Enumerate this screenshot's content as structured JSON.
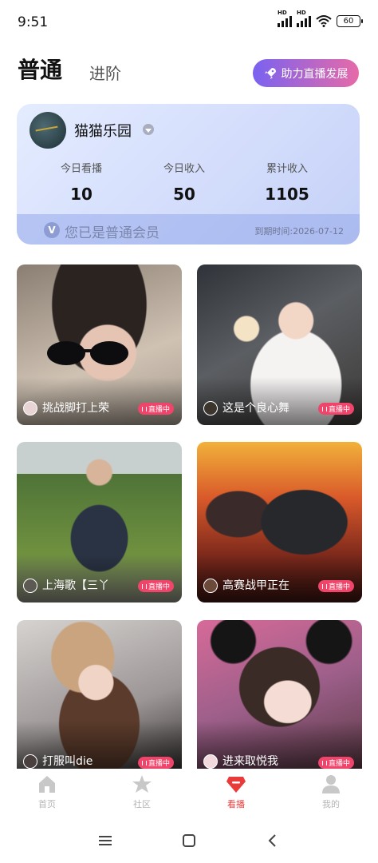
{
  "status_bar": {
    "time": "9:51",
    "battery": "60",
    "signal1": "HD",
    "signal2": "HD"
  },
  "tabs": {
    "normal": "普通",
    "advanced": "进阶"
  },
  "boost_button": {
    "label": "助力直播发展"
  },
  "member_card": {
    "name": "猫猫乐园",
    "stats": [
      {
        "label": "今日看播",
        "value": "10"
      },
      {
        "label": "今日收入",
        "value": "50"
      },
      {
        "label": "累计收入",
        "value": "1105"
      }
    ],
    "badge_letter": "V",
    "member_status": "您已是普通会员",
    "expire": "到期时间:2026-07-12"
  },
  "live_badge": "直播中",
  "streams": [
    {
      "title": "挑战脚打上荣"
    },
    {
      "title": "这是个良心舞"
    },
    {
      "title": "上海歌【三丫"
    },
    {
      "title": "高赛战甲正在"
    },
    {
      "title": "打服叫die"
    },
    {
      "title": "进来取悦我"
    }
  ],
  "bottom_nav": [
    {
      "label": "首页",
      "icon": "home-icon"
    },
    {
      "label": "社区",
      "icon": "star-icon"
    },
    {
      "label": "看播",
      "icon": "diamond-icon"
    },
    {
      "label": "我的",
      "icon": "person-icon"
    }
  ],
  "colors": {
    "accent_red": "#ea3b3b",
    "live_pink": "#f0446b",
    "gradient_start": "#7a62f0",
    "gradient_end": "#e66aa8"
  }
}
